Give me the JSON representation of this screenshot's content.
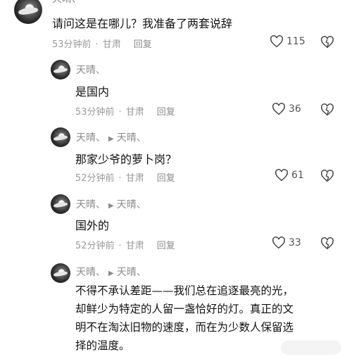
{
  "comments": [
    {
      "name": "天晴、",
      "content": "请问这是在哪儿？我准备了两套说辞",
      "time": "53分钟前",
      "location": "甘肃",
      "reply_label": "回复",
      "likes": "115"
    },
    {
      "name": "天晴、",
      "content": "是国内",
      "time": "53分钟前",
      "location": "甘肃",
      "reply_label": "回复",
      "likes": "36"
    },
    {
      "name": "天晴、",
      "reply_to": "天晴、",
      "content": "那家少爷的萝卜岗？",
      "time": "52分钟前",
      "location": "甘肃",
      "reply_label": "回复",
      "likes": "61"
    },
    {
      "name": "天晴、",
      "reply_to": "天晴、",
      "content": "国外的",
      "time": "52分钟前",
      "location": "甘肃",
      "reply_label": "回复",
      "likes": "33"
    },
    {
      "name": "天晴、",
      "reply_to": "天晴、",
      "content_lines": [
        "不得不承认差距——我们总在追逐最亮的光，",
        "却鲜少为特定的人留一盏恰好的灯。真正的文",
        "明不在淘汰旧物的速度，而在为少数人保留选",
        "择的温度。"
      ]
    }
  ],
  "icons": {
    "like": "heart-outline-icon",
    "dislike": "broken-heart-outline-icon",
    "reply_arrow": "triangle-right-icon"
  }
}
